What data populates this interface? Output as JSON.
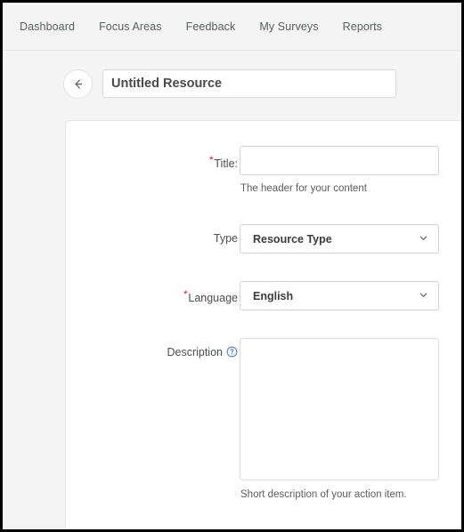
{
  "nav": {
    "items": [
      {
        "label": "Dashboard",
        "name": "nav-item-dashboard"
      },
      {
        "label": "Focus Areas",
        "name": "nav-item-focus-areas"
      },
      {
        "label": "Feedback",
        "name": "nav-item-feedback"
      },
      {
        "label": "My Surveys",
        "name": "nav-item-my-surveys"
      },
      {
        "label": "Reports",
        "name": "nav-item-reports"
      }
    ]
  },
  "title_bar": {
    "back_icon": "arrow-left-icon",
    "resource_name_value": "Untitled Resource",
    "resource_name_placeholder": "Untitled Resource"
  },
  "form": {
    "title": {
      "required_marker": "*",
      "label": "Title:",
      "value": "",
      "placeholder": "",
      "helper": "The header for your content"
    },
    "type": {
      "label": "Type",
      "selected": "Resource Type",
      "chevron_icon": "chevron-down-icon"
    },
    "language": {
      "required_marker": "*",
      "label": "Language",
      "selected": "English",
      "chevron_icon": "chevron-down-icon"
    },
    "description": {
      "label": "Description",
      "help_icon": "question-circle-icon",
      "value": "",
      "placeholder": "",
      "helper": "Short description of your action item."
    }
  },
  "colors": {
    "required_red": "#d0021b",
    "help_blue": "#2f6fd0",
    "page_background": "#f4f4f4",
    "card_background": "#ffffff",
    "text_primary": "#3c3c3c",
    "text_muted": "#5b5f5f",
    "border": "#d5d5d5"
  }
}
